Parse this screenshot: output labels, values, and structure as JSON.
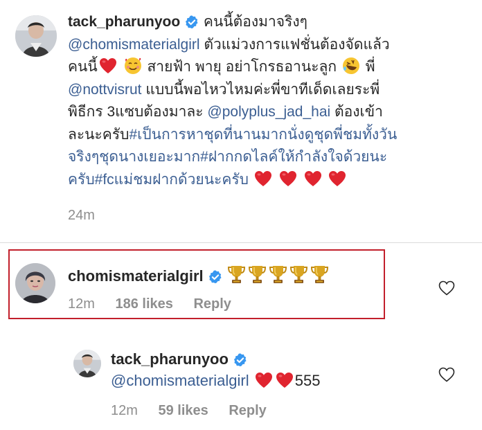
{
  "comment1": {
    "username": "tack_pharunyoo",
    "line1": "คนนี้ต้องมาจริงๆ",
    "mention1": "@chomismaterialgirl",
    "line2": "ตัวแม่วงการแฟชั่นต้องจัดแล้ว",
    "line3a": "คนนี้",
    "line3b": "สายฟ้า พายุ อย่าโกรธอานะลูก",
    "line3c": "พี่",
    "mention2": "@nottvisrut",
    "line4": "แบบนี้พอไหวไหมค่ะพี่ขาทีเด็ดเลยระพี่",
    "line5a": "พิธีกร 3แซบต้องมาละ",
    "mention3": "@polyplus_jad_hai",
    "line5b": "ต้องเข้า",
    "line6a": "ละนะครับ",
    "hashtag1": "#เป็นการหาชุดที่นานมากนั่งดูชุดพี่ชมทั้งวัน",
    "hashtag1b": "จริงๆชุดนางเยอะมาก",
    "hashtag2": "#ฝากกดไลค์ให้กำลังใจด้วยนะ",
    "hashtag2b": "ครับ",
    "hashtag3": "#fcแม่ชมฝากด้วยนะครับ",
    "time": "24m"
  },
  "comment2": {
    "username": "chomismaterialgirl",
    "time": "12m",
    "likes": "186 likes",
    "reply": "Reply"
  },
  "comment3": {
    "username": "tack_pharunyoo",
    "mention": "@chomismaterialgirl",
    "text_after": "555",
    "time": "12m",
    "likes": "59 likes",
    "reply": "Reply"
  },
  "colors": {
    "mention": "#3b5e92",
    "verified": "#3897f0",
    "highlight_border": "#c21f2b",
    "heart": "#e0242f"
  },
  "icons": [
    "verified-badge-icon",
    "trophy-icon",
    "heart-emoji-icon",
    "rofl-emoji-icon",
    "smiling-hearts-emoji-icon",
    "heart-outline-icon"
  ]
}
